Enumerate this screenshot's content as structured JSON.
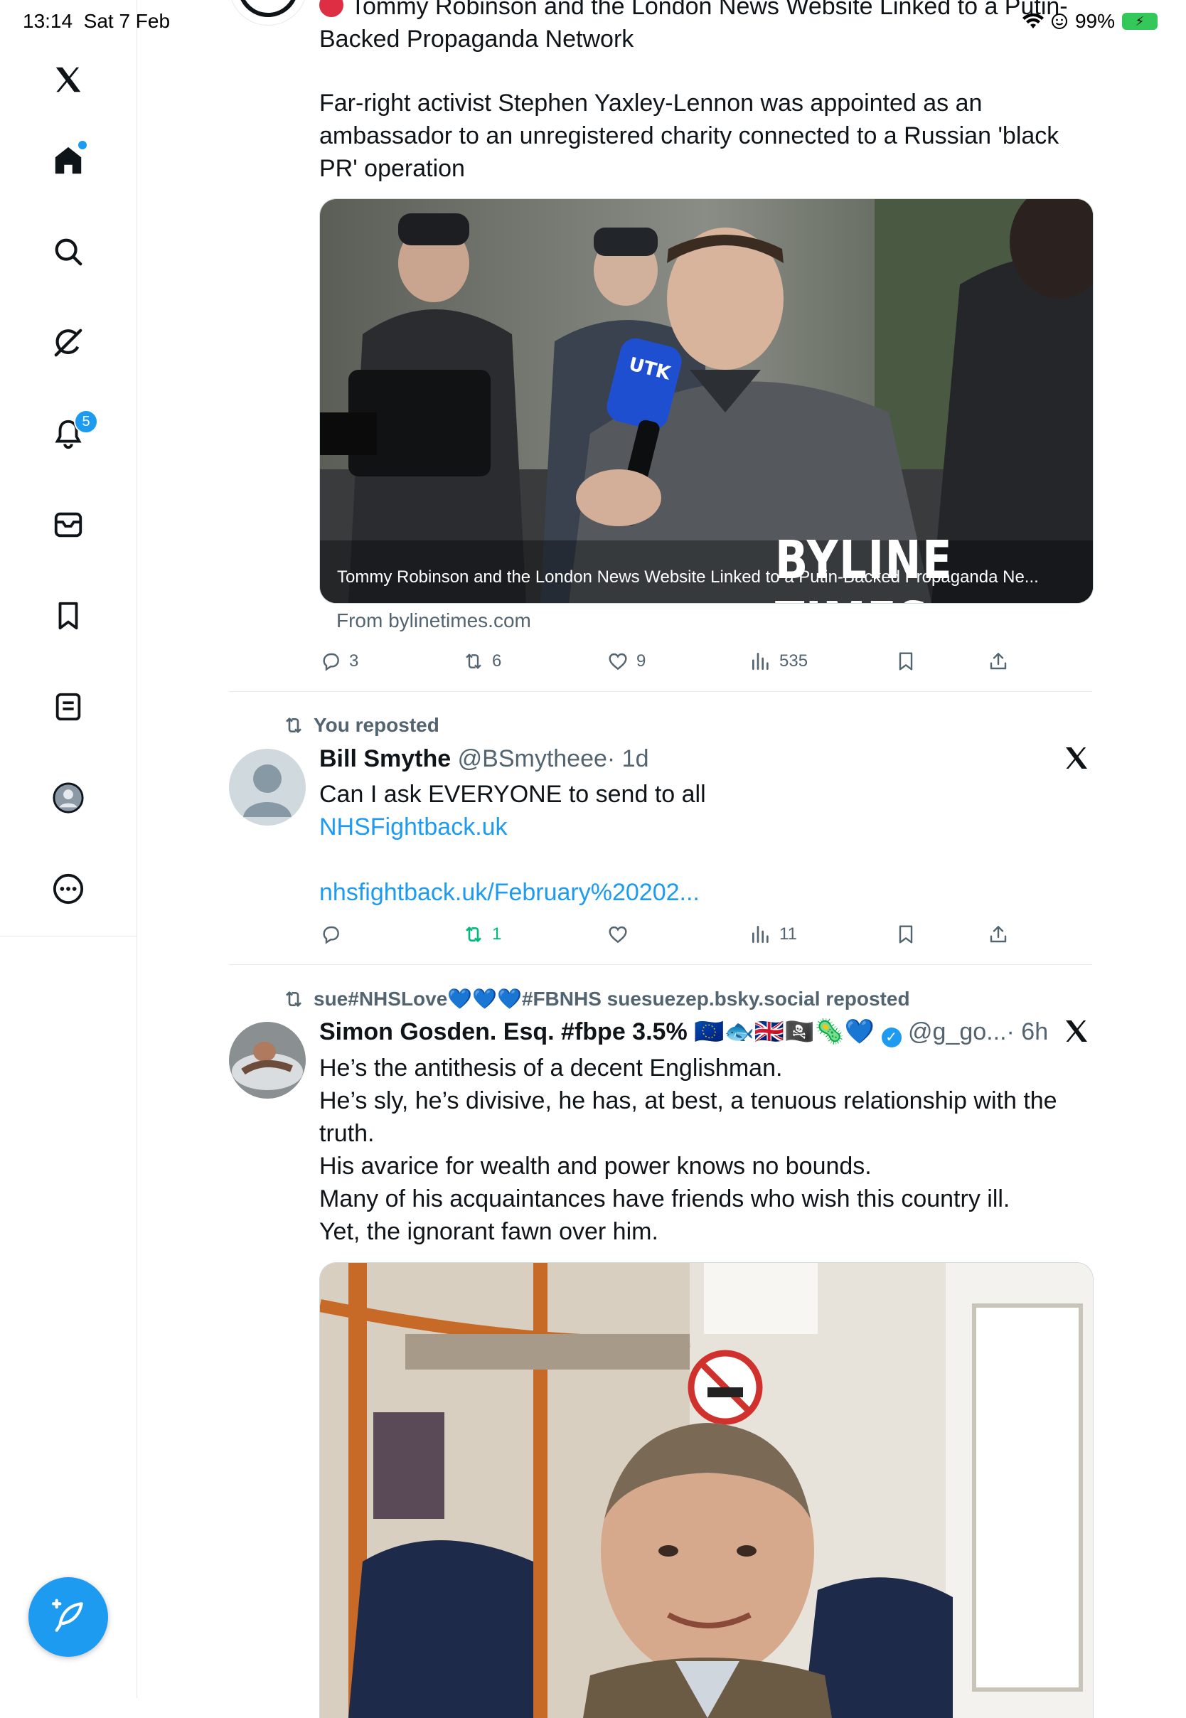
{
  "status_bar": {
    "time": "13:14",
    "date": "Sat 7 Feb",
    "battery": "99%"
  },
  "sidebar": {
    "items": [
      {
        "name": "x-logo"
      },
      {
        "name": "home"
      },
      {
        "name": "search"
      },
      {
        "name": "grok"
      },
      {
        "name": "notifications",
        "badge": "5"
      },
      {
        "name": "messages"
      },
      {
        "name": "bookmarks"
      },
      {
        "name": "lists"
      },
      {
        "name": "profile"
      },
      {
        "name": "more"
      }
    ]
  },
  "post1": {
    "title_line1": "Tommy Robinson and the London News Website Linked to a Putin-",
    "title_line2": "Backed Propaganda Network",
    "body_line1": "Far-right activist Stephen Yaxley-Lennon was appointed as an",
    "body_line2": "ambassador to an unregistered charity connected to a Russian 'black",
    "body_line3": "PR' operation",
    "card_caption": "Tommy Robinson and the London News Website Linked to a Putin-Backed Propaganda Ne...",
    "card_watermark": "BYLINE TIMES",
    "mic_label": "UTK",
    "card_source": "From bylinetimes.com",
    "replies": "3",
    "reposts": "6",
    "likes": "9",
    "views": "535"
  },
  "post2": {
    "repost_label": "You reposted",
    "author": "Bill Smythe",
    "handle": "@BSmytheee",
    "time": "· 1d",
    "line1": "Can I ask EVERYONE to send to all",
    "link1": "NHSFightback.uk",
    "link2": "nhsfightback.uk/February%20202...",
    "replies": "",
    "reposts": "1",
    "likes": "",
    "views": "11"
  },
  "post3": {
    "repost_label": "sue#NHSLove💙💙💙#FBNHS suesuezep.bsky.social reposted",
    "author": "Simon Gosden. Esq. #fbpe 3.5% 🇪🇺🐟🇬🇧🏴‍☠️🦠💙",
    "handle": "@g_go...",
    "time": "· 6h",
    "line1": "He’s the antithesis of a decent Englishman.",
    "line2": "He’s sly, he’s divisive, he has, at best, a tenuous relationship with the",
    "line3": "truth.",
    "line4": "His avarice for wealth and power knows no bounds.",
    "line5": "Many of his acquaintances have friends who wish this country ill.",
    "line6": "Yet, the ignorant fawn over him."
  },
  "colors": {
    "accent": "#1d9bf0",
    "repost_green": "#00ba7c",
    "muted": "#536471"
  }
}
